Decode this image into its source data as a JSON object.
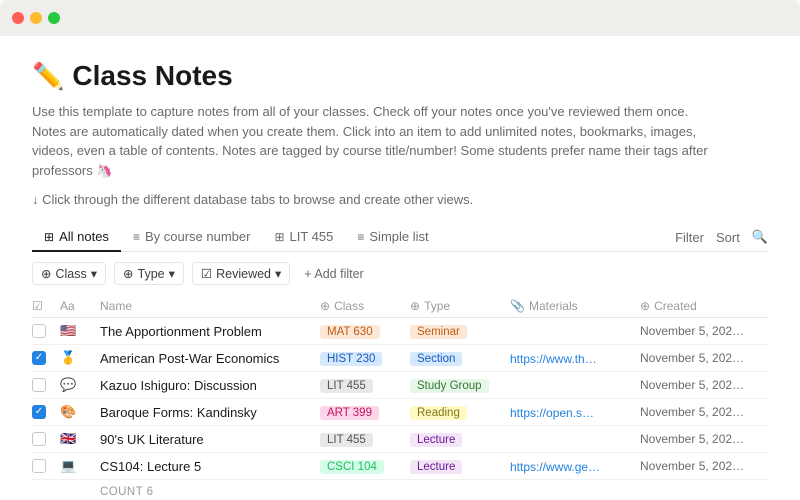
{
  "titlebar": {
    "traffic_lights": [
      "red",
      "yellow",
      "green"
    ]
  },
  "page": {
    "icon": "✏️",
    "title": "Class Notes",
    "description": "Use this template to capture notes from all of your classes. Check off your notes once you've reviewed them once. Notes are automatically dated when you create them. Click into an item to add unlimited notes, bookmarks, images, videos, even a table of contents. Notes are tagged by course title/number!  Some students prefer name their tags after professors 🦄",
    "instruction": "↓ Click through the different database tabs to browse and create other views."
  },
  "tabs": [
    {
      "id": "all-notes",
      "icon": "⊞",
      "label": "All notes",
      "active": true
    },
    {
      "id": "by-course",
      "icon": "≡",
      "label": "By course number",
      "active": false
    },
    {
      "id": "lit-455",
      "icon": "⊞",
      "label": "LIT 455",
      "active": false
    },
    {
      "id": "simple-list",
      "icon": "≡",
      "label": "Simple list",
      "active": false
    }
  ],
  "tab_actions": {
    "filter": "Filter",
    "sort": "Sort",
    "search": "🔍"
  },
  "filter_chips": [
    {
      "icon": "⊕",
      "label": "Class",
      "caret": "▾"
    },
    {
      "icon": "⊕",
      "label": "Type",
      "caret": "▾"
    },
    {
      "icon": "☑",
      "label": "Reviewed",
      "caret": "▾"
    }
  ],
  "add_filter_label": "+ Add filter",
  "table": {
    "headers": [
      {
        "id": "reviewed",
        "icon": "☑",
        "label": "Reviewed"
      },
      {
        "id": "name",
        "icon": "Aa",
        "label": "Name"
      },
      {
        "id": "class",
        "icon": "⊕",
        "label": "Class"
      },
      {
        "id": "type",
        "icon": "⊕",
        "label": "Type"
      },
      {
        "id": "materials",
        "icon": "📎",
        "label": "Materials"
      },
      {
        "id": "created",
        "icon": "⊕",
        "label": "Created"
      }
    ],
    "rows": [
      {
        "checked": false,
        "emoji": "🇺🇸",
        "name": "The Apportionment Problem",
        "class": "MAT 630",
        "class_color": "mat630",
        "type": "Seminar",
        "type_color": "type-seminar",
        "materials": "",
        "created": "November 5, 202…"
      },
      {
        "checked": true,
        "emoji": "🥇",
        "name": "American Post-War Economics",
        "class": "HIST 230",
        "class_color": "hist230",
        "type": "Section",
        "type_color": "type-section",
        "materials": "https://www.th…",
        "created": "November 5, 202…"
      },
      {
        "checked": false,
        "emoji": "💬",
        "name": "Kazuo Ishiguro: Discussion",
        "class": "LIT 455",
        "class_color": "lit455",
        "type": "Study Group",
        "type_color": "type-studygroup",
        "materials": "",
        "created": "November 5, 202…"
      },
      {
        "checked": true,
        "emoji": "🎨",
        "name": "Baroque Forms: Kandinsky",
        "class": "ART 399",
        "class_color": "art399",
        "type": "Reading",
        "type_color": "type-reading",
        "materials": "https://open.s…",
        "created": "November 5, 202…"
      },
      {
        "checked": false,
        "emoji": "🇬🇧",
        "name": "90's UK Literature",
        "class": "LIT 455",
        "class_color": "lit455",
        "type": "Lecture",
        "type_color": "type-lecture",
        "materials": "",
        "created": "November 5, 202…"
      },
      {
        "checked": false,
        "emoji": "💻",
        "name": "CS104: Lecture 5",
        "class": "CSCI 104",
        "class_color": "csci104",
        "type": "Lecture",
        "type_color": "type-lecture",
        "materials": "https://www.ge…",
        "created": "November 5, 202…"
      }
    ]
  },
  "count_label": "COUNT",
  "count_value": "6"
}
